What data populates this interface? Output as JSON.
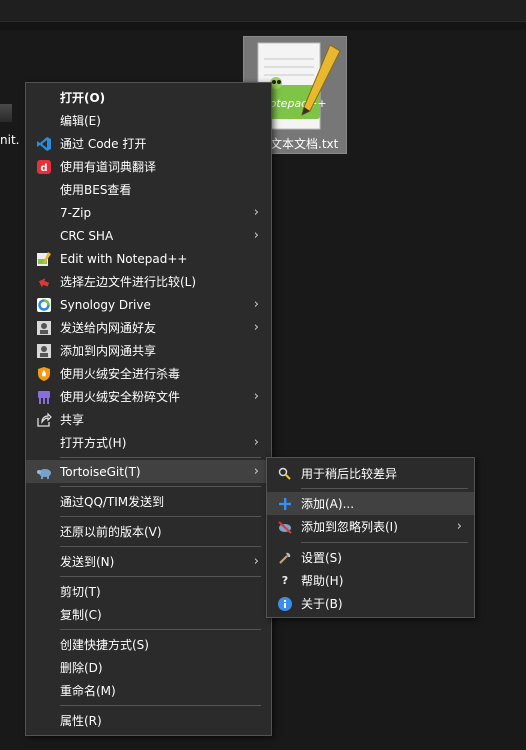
{
  "desktop": {
    "partial_file_name": "nit.",
    "file_name": "文本文档.txt"
  },
  "main_menu": {
    "items": [
      {
        "label": "打开(O)",
        "icon": "none",
        "bold": true
      },
      {
        "label": "编辑(E)",
        "icon": "none"
      },
      {
        "label": "通过 Code 打开",
        "icon": "vscode-icon"
      },
      {
        "label": "使用有道词典翻译",
        "icon": "youdao-icon"
      },
      {
        "label": "使用BES查看",
        "icon": "none"
      },
      {
        "label": "7-Zip",
        "icon": "none",
        "submenu": true
      },
      {
        "label": "CRC SHA",
        "icon": "none",
        "submenu": true
      },
      {
        "label": "Edit with Notepad++",
        "icon": "notepadpp-icon"
      },
      {
        "label": "选择左边文件进行比较(L)",
        "icon": "compare-icon"
      },
      {
        "label": "Synology Drive",
        "icon": "synology-drive-icon",
        "submenu": true
      },
      {
        "label": "发送给内网通好友",
        "icon": "intranet-icon",
        "submenu": true
      },
      {
        "label": "添加到内网通共享",
        "icon": "intranet-share-icon"
      },
      {
        "label": "使用火绒安全进行杀毒",
        "icon": "huorong-shield-icon"
      },
      {
        "label": "使用火绒安全粉碎文件",
        "icon": "huorong-shredder-icon",
        "submenu": true
      },
      {
        "label": "共享",
        "icon": "share-icon"
      },
      {
        "label": "打开方式(H)",
        "icon": "none",
        "submenu": true
      },
      {
        "label": "TortoiseGit(T)",
        "icon": "tortoisegit-icon",
        "submenu": true
      },
      {
        "label": "通过QQ/TIM发送到",
        "icon": "none"
      },
      {
        "label": "还原以前的版本(V)",
        "icon": "none"
      },
      {
        "label": "发送到(N)",
        "icon": "none",
        "submenu": true
      },
      {
        "label": "剪切(T)",
        "icon": "none"
      },
      {
        "label": "复制(C)",
        "icon": "none"
      },
      {
        "label": "创建快捷方式(S)",
        "icon": "none"
      },
      {
        "label": "删除(D)",
        "icon": "none"
      },
      {
        "label": "重命名(M)",
        "icon": "none"
      },
      {
        "label": "属性(R)",
        "icon": "none"
      }
    ]
  },
  "sub_menu": {
    "items": [
      {
        "label": "用于稍后比较差异",
        "icon": "diff-later-icon"
      },
      {
        "label": "添加(A)...",
        "icon": "add-plus-icon"
      },
      {
        "label": "添加到忽略列表(I)",
        "icon": "ignore-list-icon",
        "submenu": true
      },
      {
        "label": "设置(S)",
        "icon": "settings-icon"
      },
      {
        "label": "帮助(H)",
        "icon": "help-icon"
      },
      {
        "label": "关于(B)",
        "icon": "about-info-icon"
      }
    ]
  },
  "colors": {
    "menu_bg": "#2b2b2b",
    "highlight": "#414141",
    "accent_blue": "#3b8eea"
  }
}
